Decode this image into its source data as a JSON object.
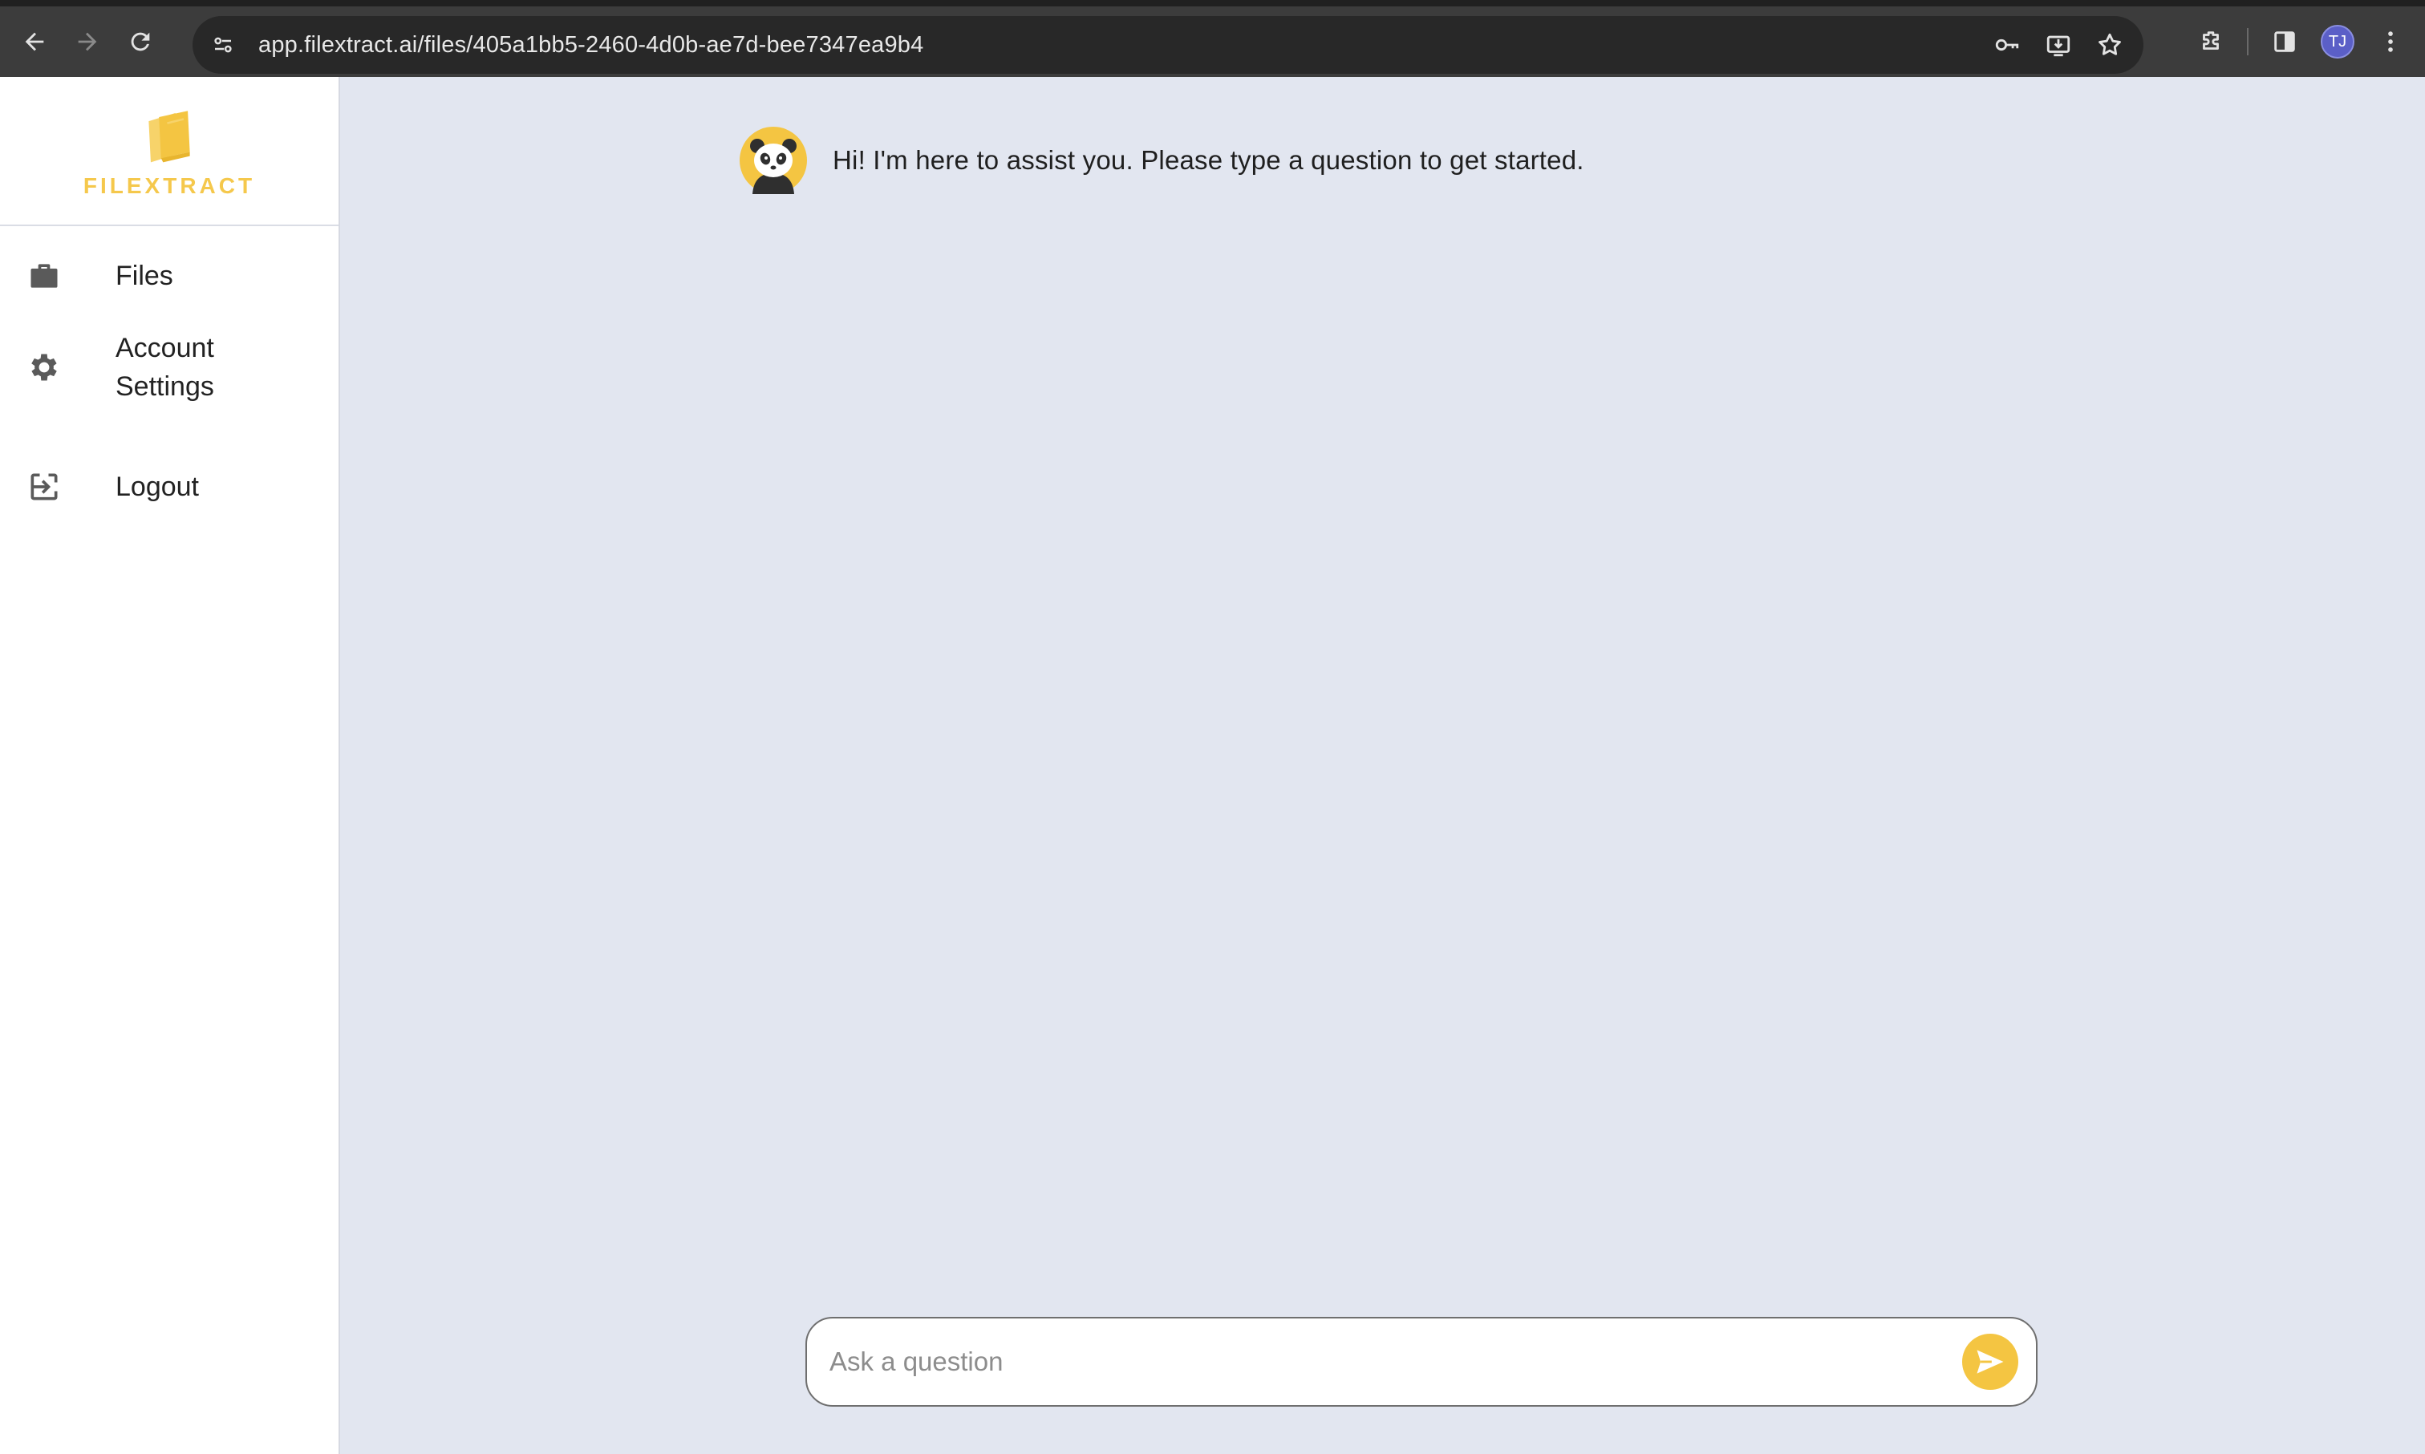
{
  "browser": {
    "url": "app.filextract.ai/files/405a1bb5-2460-4d0b-ae7d-bee7347ea9b4",
    "profile_initials": "TJ",
    "profile_color": "#5b5fc7"
  },
  "sidebar": {
    "logo_text": "FILEXTRACT",
    "brand_color": "#f5c84c",
    "items": [
      {
        "label": "Files",
        "icon": "briefcase-icon"
      },
      {
        "label": "Account Settings",
        "icon": "gear-icon"
      },
      {
        "label": "Logout",
        "icon": "logout-icon"
      }
    ]
  },
  "chat": {
    "messages": [
      {
        "sender": "bot",
        "avatar": "panda-avatar",
        "text": "Hi! I'm here to assist you. Please type a question to get started."
      }
    ],
    "input_placeholder": "Ask a question",
    "input_value": "",
    "send_icon": "send-icon",
    "accent_color": "#f4c542"
  }
}
